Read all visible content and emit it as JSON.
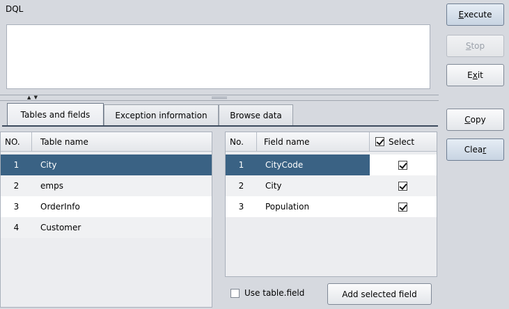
{
  "dql": {
    "label": "DQL",
    "query": ""
  },
  "tabs": [
    {
      "label": "Tables and fields",
      "active": true
    },
    {
      "label": "Exception information",
      "active": false
    },
    {
      "label": "Browse data",
      "active": false
    }
  ],
  "tables_table": {
    "columns": [
      "NO.",
      "Table name"
    ],
    "rows": [
      {
        "no": "1",
        "name": "City",
        "selected": true
      },
      {
        "no": "2",
        "name": "emps",
        "selected": false
      },
      {
        "no": "3",
        "name": "OrderInfo",
        "selected": false
      },
      {
        "no": "4",
        "name": "Customer",
        "selected": false
      }
    ]
  },
  "fields_table": {
    "columns": [
      "No.",
      "Field name",
      "Select"
    ],
    "header_select_checked": true,
    "rows": [
      {
        "no": "1",
        "name": "CityCode",
        "checked": true,
        "selected": true
      },
      {
        "no": "2",
        "name": "City",
        "checked": true,
        "selected": false
      },
      {
        "no": "3",
        "name": "Population",
        "checked": true,
        "selected": false
      }
    ]
  },
  "use_table_field": {
    "label": "Use table.field",
    "checked": false
  },
  "add_selected_field": {
    "label": "Add selected field"
  },
  "buttons": {
    "execute": {
      "pre": "",
      "mnemonic": "E",
      "post": "xecute"
    },
    "stop": {
      "pre": "",
      "mnemonic": "S",
      "post": "top"
    },
    "exit": {
      "pre": "E",
      "mnemonic": "x",
      "post": "it"
    },
    "copy": {
      "pre": "",
      "mnemonic": "C",
      "post": "opy"
    },
    "clear": {
      "pre": "Clea",
      "mnemonic": "r",
      "post": ""
    }
  }
}
